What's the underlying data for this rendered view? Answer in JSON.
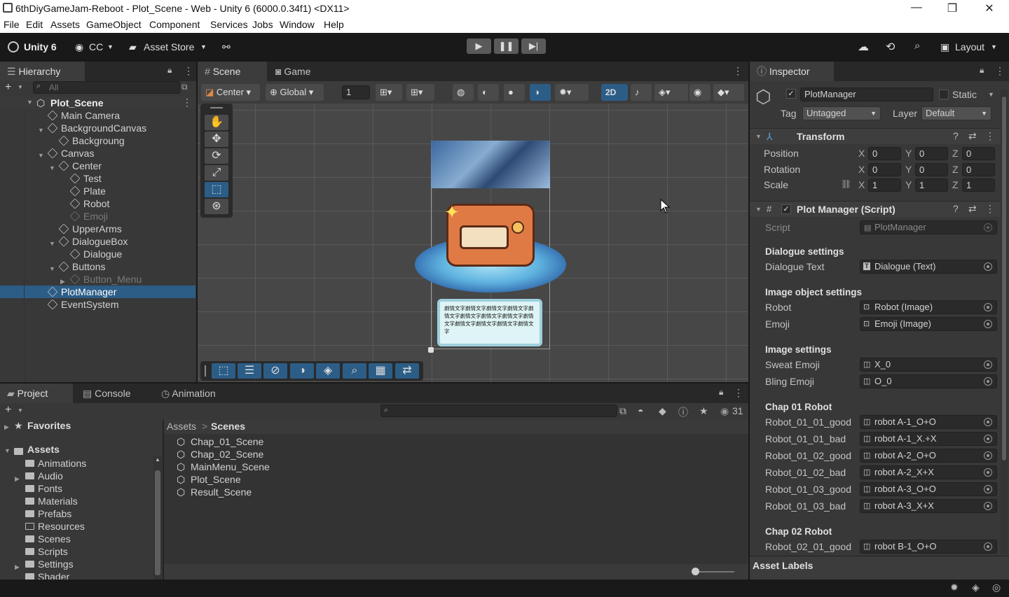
{
  "window": {
    "title": "6thDiyGameJam-Reboot - Plot_Scene - Web - Unity 6 (6000.0.34f1) <DX11>"
  },
  "menu": [
    "File",
    "Edit",
    "Assets",
    "GameObject",
    "Component",
    "Services",
    "Jobs",
    "Window",
    "Help"
  ],
  "toolbar": {
    "brand": "Unity 6",
    "account": "CC",
    "asset_store": "Asset Store",
    "layout": "Layout"
  },
  "hierarchy": {
    "tab": "Hierarchy",
    "search_placeholder": "All",
    "scene": "Plot_Scene",
    "items": [
      {
        "label": "Main Camera",
        "depth": 1,
        "arrow": ""
      },
      {
        "label": "BackgroundCanvas",
        "depth": 1,
        "arrow": "down"
      },
      {
        "label": "Backgroung",
        "depth": 2,
        "arrow": ""
      },
      {
        "label": "Canvas",
        "depth": 1,
        "arrow": "down"
      },
      {
        "label": "Center",
        "depth": 2,
        "arrow": "down"
      },
      {
        "label": "Test",
        "depth": 3,
        "arrow": ""
      },
      {
        "label": "Plate",
        "depth": 3,
        "arrow": ""
      },
      {
        "label": "Robot",
        "depth": 3,
        "arrow": ""
      },
      {
        "label": "Emoji",
        "depth": 3,
        "arrow": "",
        "disabled": true
      },
      {
        "label": "UpperArms",
        "depth": 2,
        "arrow": ""
      },
      {
        "label": "DialogueBox",
        "depth": 2,
        "arrow": "down"
      },
      {
        "label": "Dialogue",
        "depth": 3,
        "arrow": ""
      },
      {
        "label": "Buttons",
        "depth": 2,
        "arrow": "down"
      },
      {
        "label": "Button_Menu",
        "depth": 3,
        "arrow": "right",
        "disabled": true
      },
      {
        "label": "PlotManager",
        "depth": 1,
        "arrow": "",
        "selected": true
      },
      {
        "label": "EventSystem",
        "depth": 1,
        "arrow": ""
      }
    ]
  },
  "scene_view": {
    "tabs": [
      "Scene",
      "Game"
    ],
    "pivot": "Center",
    "space": "Global",
    "snap": "1",
    "mode_2d": "2D",
    "dialogue_text": "劇情文字劇情文字劇情文字劇情文字劇情文字劇情文字劇情文字劇情文字劇情文字劇情文字劇情文字劇情文字劇情文字"
  },
  "inspector": {
    "tab": "Inspector",
    "object_name": "PlotManager",
    "static_label": "Static",
    "tag_label": "Tag",
    "tag": "Untagged",
    "layer_label": "Layer",
    "layer": "Default",
    "transform": {
      "title": "Transform",
      "position_label": "Position",
      "rotation_label": "Rotation",
      "scale_label": "Scale",
      "position": [
        "0",
        "0",
        "0"
      ],
      "rotation": [
        "0",
        "0",
        "0"
      ],
      "scale": [
        "1",
        "1",
        "1"
      ]
    },
    "script": {
      "title": "Plot Manager (Script)",
      "script_label": "Script",
      "script_value": "PlotManager"
    },
    "sections": [
      {
        "header": "Dialogue settings",
        "rows": [
          {
            "label": "Dialogue Text",
            "value": "Dialogue (Text)",
            "icon": "T"
          }
        ]
      },
      {
        "header": "Image object settings",
        "rows": [
          {
            "label": "Robot",
            "value": "Robot (Image)",
            "icon": "img"
          },
          {
            "label": "Emoji",
            "value": "Emoji (Image)",
            "icon": "img"
          }
        ]
      },
      {
        "header": "Image settings",
        "rows": [
          {
            "label": "Sweat Emoji",
            "value": "X_0",
            "icon": "spr"
          },
          {
            "label": "Bling Emoji",
            "value": "O_0",
            "icon": "spr"
          }
        ]
      },
      {
        "header": "Chap 01 Robot",
        "rows": [
          {
            "label": "Robot_01_01_good",
            "value": "robot A-1_O+O",
            "icon": "spr"
          },
          {
            "label": "Robot_01_01_bad",
            "value": "robot A-1_X.+X",
            "icon": "spr"
          },
          {
            "label": "Robot_01_02_good",
            "value": "robot A-2_O+O",
            "icon": "spr"
          },
          {
            "label": "Robot_01_02_bad",
            "value": "robot A-2_X+X",
            "icon": "spr"
          },
          {
            "label": "Robot_01_03_good",
            "value": "robot A-3_O+O",
            "icon": "spr"
          },
          {
            "label": "Robot_01_03_bad",
            "value": "robot A-3_X+X",
            "icon": "spr"
          }
        ]
      },
      {
        "header": "Chap 02 Robot",
        "rows": [
          {
            "label": "Robot_02_01_good",
            "value": "robot B-1_O+O",
            "icon": "spr"
          }
        ]
      }
    ],
    "asset_labels": "Asset Labels"
  },
  "project": {
    "tabs": [
      "Project",
      "Console",
      "Animation"
    ],
    "favorites": "Favorites",
    "assets_root": "Assets",
    "folders": [
      "Animations",
      "Audio",
      "Fonts",
      "Materials",
      "Prefabs",
      "Resources",
      "Scenes",
      "Scripts",
      "Settings",
      "Shader"
    ],
    "breadcrumb": [
      "Assets",
      "Scenes"
    ],
    "files": [
      "Chap_01_Scene",
      "Chap_02_Scene",
      "MainMenu_Scene",
      "Plot_Scene",
      "Result_Scene"
    ],
    "hidden_count": "31"
  },
  "colors": {
    "accent": "#2c5d87",
    "panel": "#383838",
    "header": "#282828"
  }
}
